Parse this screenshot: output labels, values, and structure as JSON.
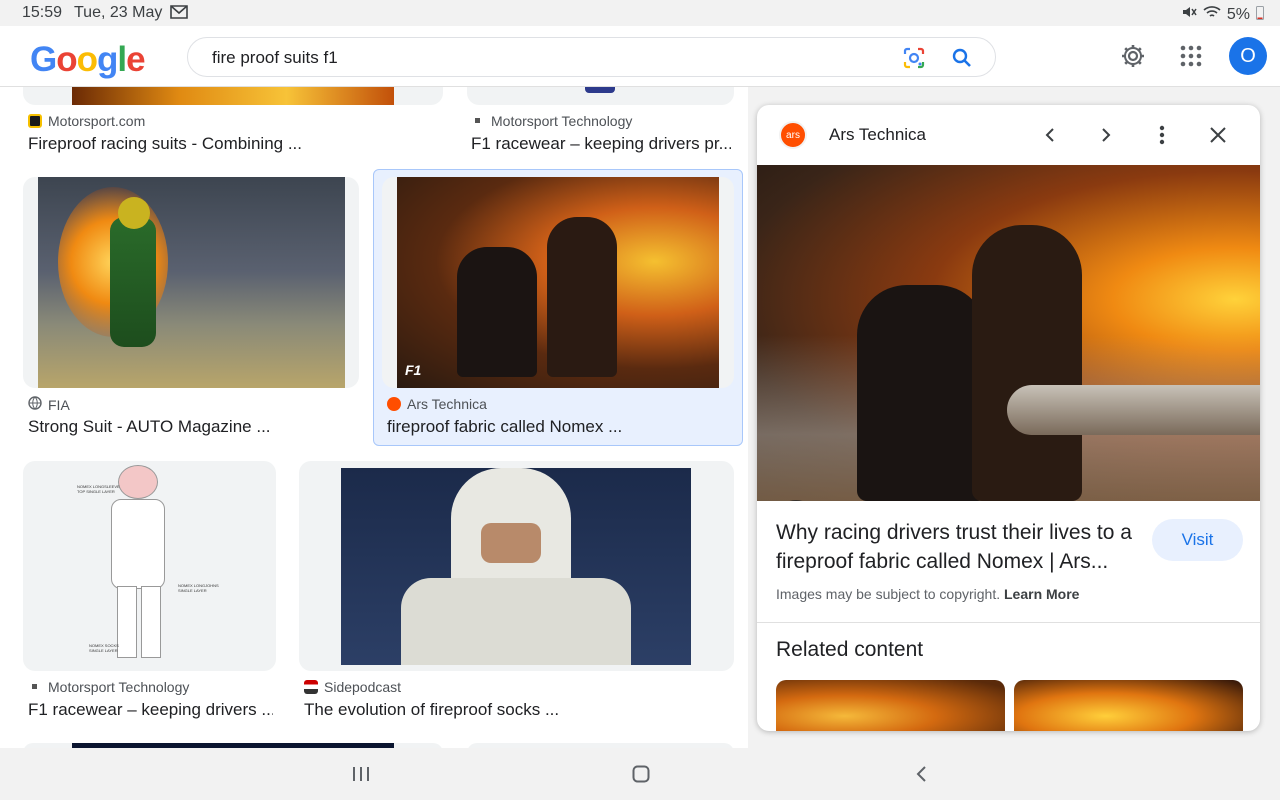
{
  "status": {
    "time": "15:59",
    "date": "Tue, 23 May",
    "battery": "5%"
  },
  "header": {
    "logo": [
      "G",
      "o",
      "o",
      "g",
      "l",
      "e"
    ],
    "query": "fire proof suits f1",
    "avatar": "O"
  },
  "results": {
    "row1": [
      {
        "source": "Motorsport.com",
        "title": "Fireproof racing suits - Combining ..."
      },
      {
        "source": "Motorsport Technology",
        "title": "F1 racewear – keeping drivers pr..."
      }
    ],
    "row2": [
      {
        "source": "FIA",
        "title": "Strong Suit - AUTO Magazine ..."
      },
      {
        "source": "Ars Technica",
        "title": "fireproof fabric called Nomex ..."
      }
    ],
    "row3": [
      {
        "source": "Motorsport Technology",
        "title": "F1 racewear – keeping drivers ..."
      },
      {
        "source": "Sidepodcast",
        "title": "The evolution of fireproof socks ..."
      }
    ],
    "suit_labels": [
      "NOMEX LONGSLEEVE TOP SINGLE LAYER",
      "NOMEX LONGJOHNS SINGLE LAYER",
      "NOMEX SOCKS SINGLE LAYER"
    ]
  },
  "panel": {
    "logo_text": "ars",
    "site": "Ars Technica",
    "title": "Why racing drivers trust their lives to a fireproof fabric called Nomex | Ars...",
    "visit": "Visit",
    "copyright": "Images may be subject to copyright.",
    "learn_more": "Learn More",
    "related": "Related content"
  },
  "colors": {
    "accent": "#1a73e8",
    "selected_bg": "#e8f0fe",
    "ars": "#ff4e00"
  }
}
